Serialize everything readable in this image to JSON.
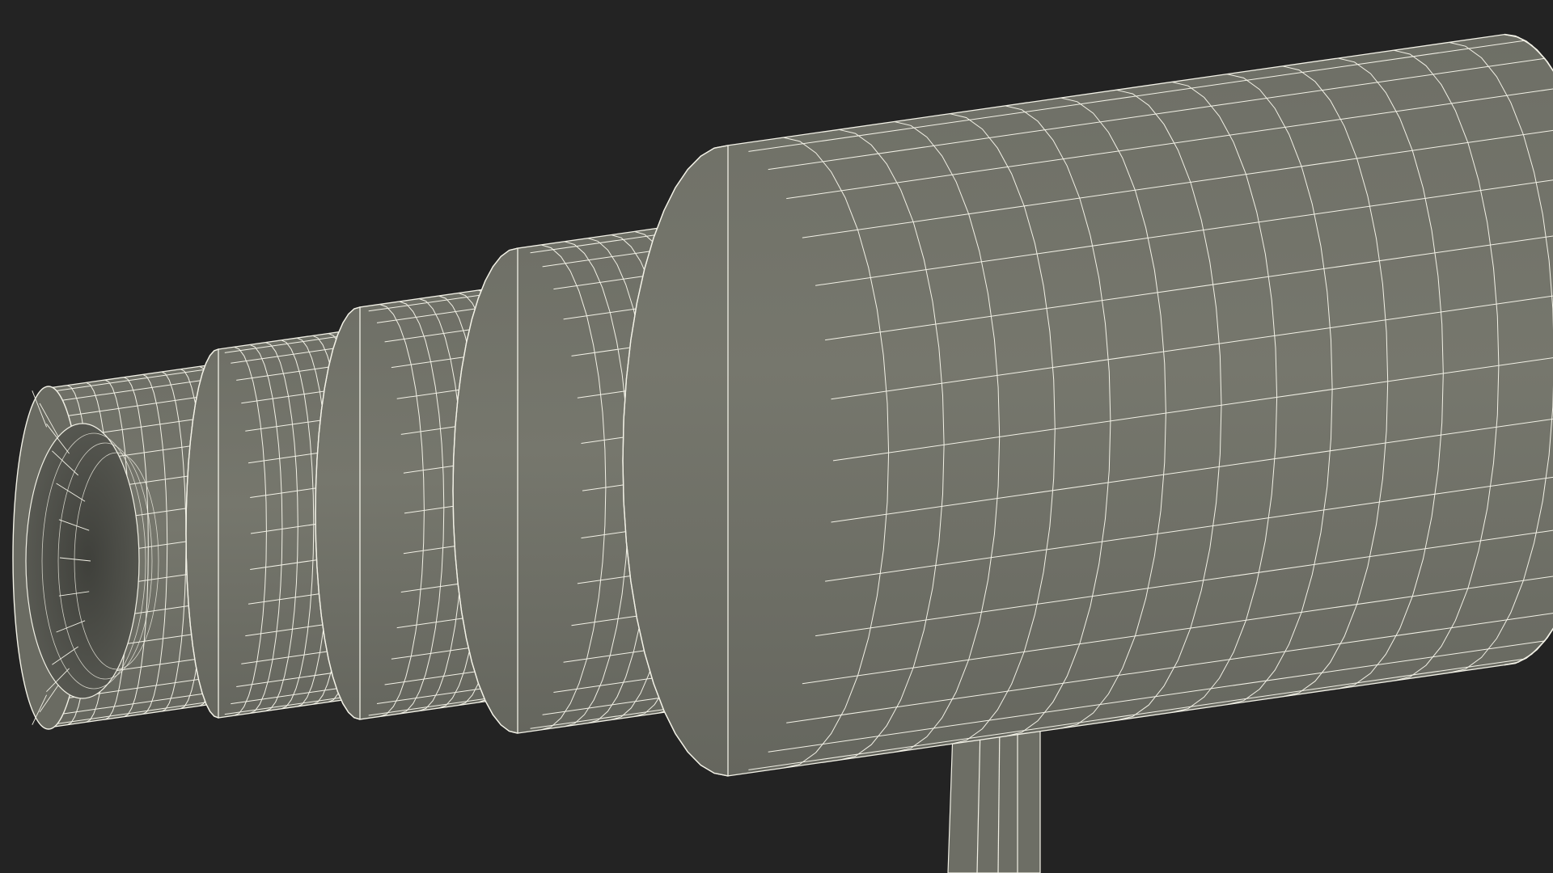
{
  "scene": {
    "subject": "wireframe-cylindrical-part",
    "display_mode": "shaded-wireframe"
  },
  "colors": {
    "background": "#232323",
    "surface": "#73746a",
    "surface_dark": "#5f6058",
    "surface_shadow": "#4e4f48",
    "wire": "#f2f1e6"
  }
}
